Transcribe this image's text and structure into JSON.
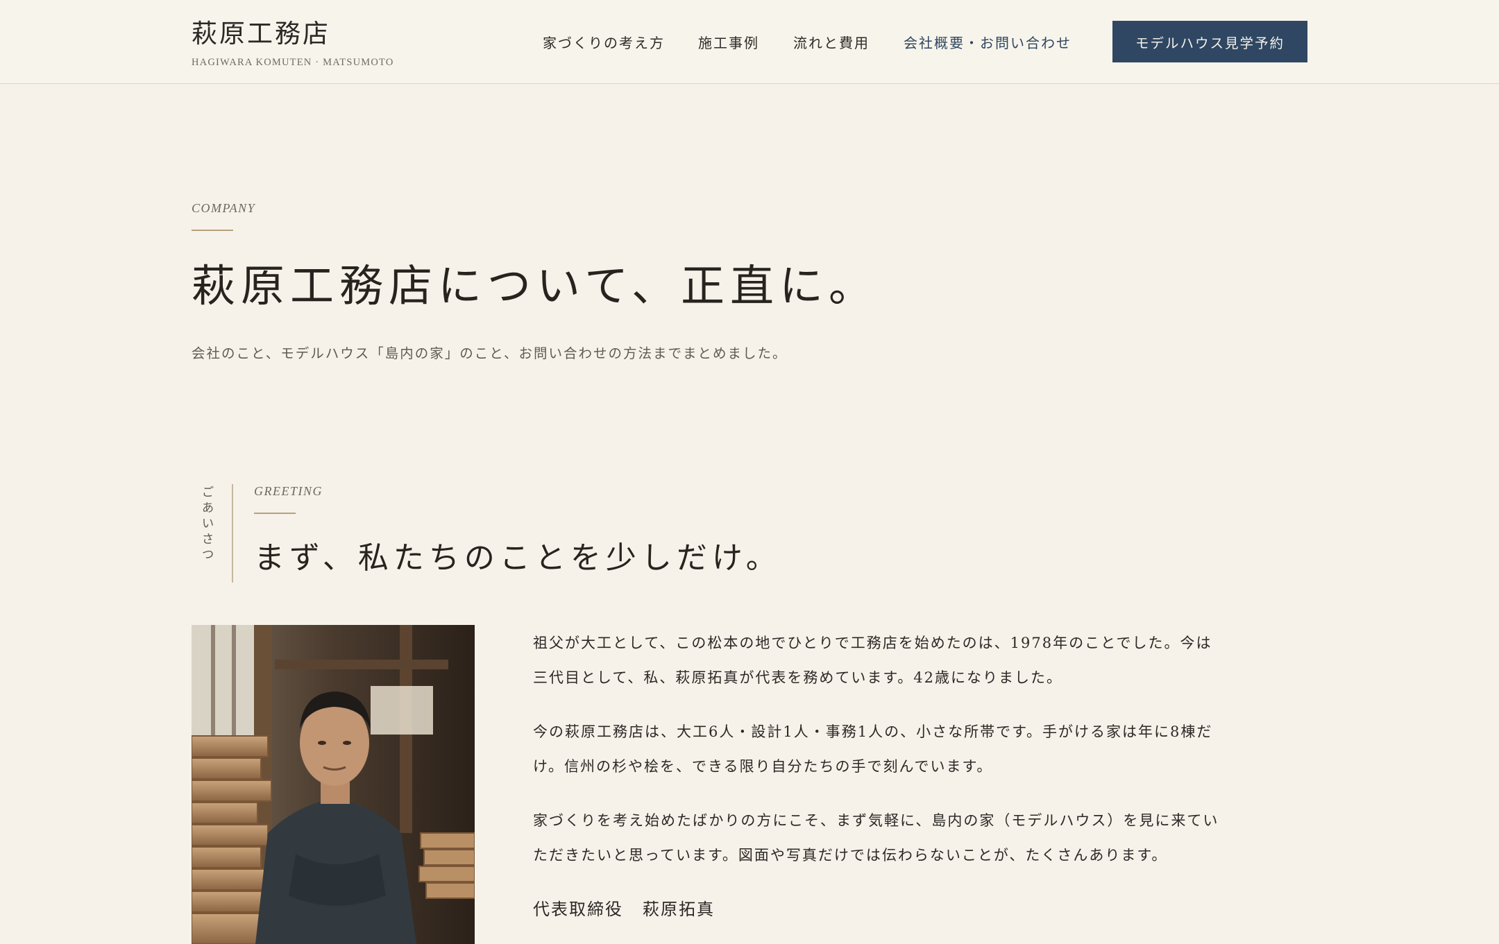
{
  "header": {
    "brand_name": "萩原工務店",
    "brand_sub": "HAGIWARA KOMUTEN · MATSUMOTO",
    "nav": [
      {
        "label": "家づくりの考え方"
      },
      {
        "label": "施工事例"
      },
      {
        "label": "流れと費用"
      },
      {
        "label": "会社概要・お問い合わせ"
      }
    ],
    "cta_label": "モデルハウス見学予約"
  },
  "hero": {
    "eyebrow": "COMPANY",
    "title": "萩原工務店について、正直に。",
    "lead": "会社のこと、モデルハウス「島内の家」のこと、お問い合わせの方法までまとめました。"
  },
  "greeting": {
    "vertical_label": "ごあいさつ",
    "eyebrow": "GREETING",
    "title": "まず、私たちのことを少しだけ。",
    "photo_icon": "portrait-photo",
    "paragraphs": [
      "祖父が大工として、この松本の地でひとりで工務店を始めたのは、1978年のことでした。今は三代目として、私、萩原拓真が代表を務めています。42歳になりました。",
      "今の萩原工務店は、大工6人・設計1人・事務1人の、小さな所帯です。手がける家は年に8棟だけ。信州の杉や桧を、できる限り自分たちの手で刻んでいます。",
      "家づくりを考え始めたばかりの方にこそ、まず気軽に、島内の家（モデルハウス）を見に来ていただきたいと思っています。図面や写真だけでは伝わらないことが、たくさんあります。"
    ],
    "signature_role": "代表取締役",
    "signature_name": "萩原拓真"
  },
  "colors": {
    "background": "#f6f2ea",
    "accent_navy": "#2f4762",
    "rule_gold": "#b89f7d"
  }
}
